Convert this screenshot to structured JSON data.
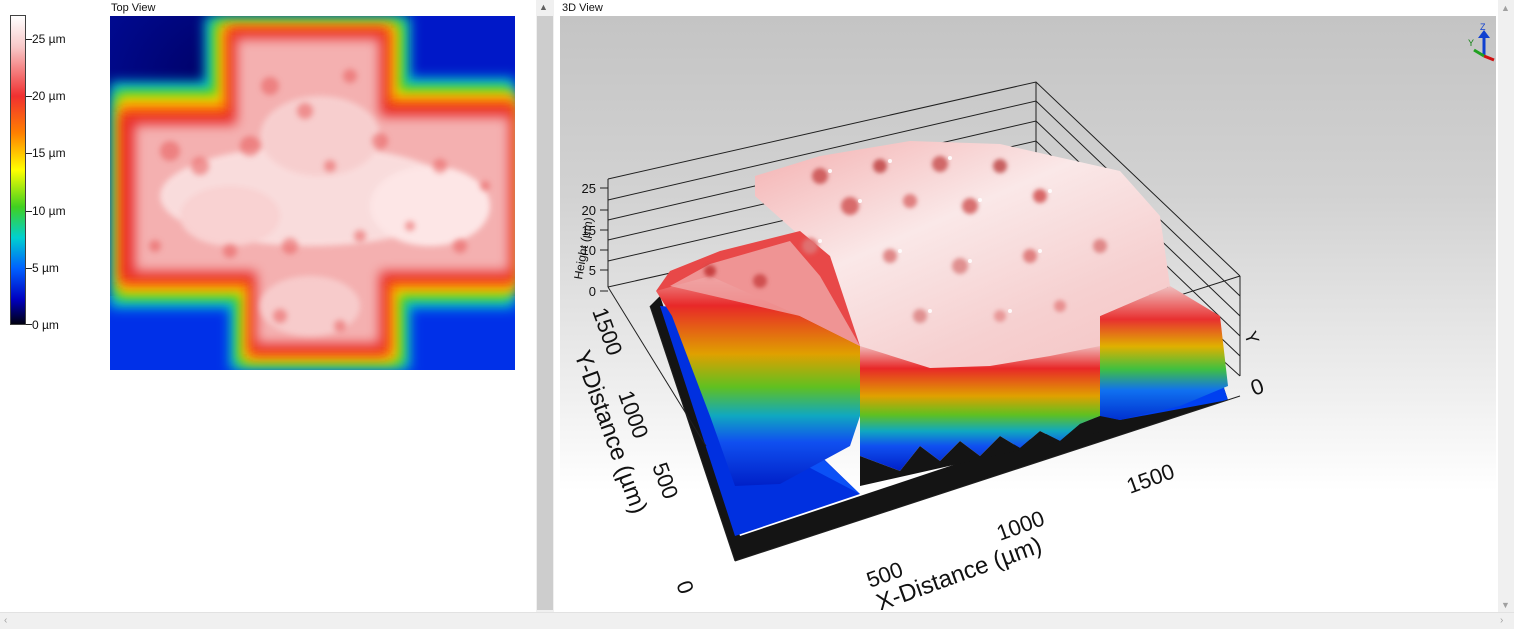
{
  "colorbar": {
    "labels": [
      "25 µm",
      "20 µm",
      "15 µm",
      "10 µm",
      "5 µm",
      "0 µm"
    ]
  },
  "top_view": {
    "title": "Top View"
  },
  "view_3d": {
    "title": "3D View",
    "z_axis": {
      "label": "Height (µm)",
      "ticks": [
        "25",
        "20",
        "15",
        "10",
        "5",
        "0"
      ]
    },
    "y_axis": {
      "label": "Y-Distance (µm)",
      "ticks": [
        "1500",
        "1000",
        "500",
        "0"
      ]
    },
    "x_axis": {
      "label": "X-Distance (µm)",
      "ticks": [
        "500",
        "1000",
        "1500"
      ]
    },
    "far_tick": "0",
    "far_y_label": "Y",
    "triad": {
      "z": "Z",
      "y": "Y"
    }
  },
  "colors": {
    "white": "#ffffff",
    "pink": "#f4b4b4",
    "red": "#e82828",
    "orange": "#ff8c00",
    "yellow": "#f0e000",
    "green": "#30c030",
    "cyan": "#00c8d8",
    "blue": "#0040ff",
    "navy": "#000090"
  }
}
